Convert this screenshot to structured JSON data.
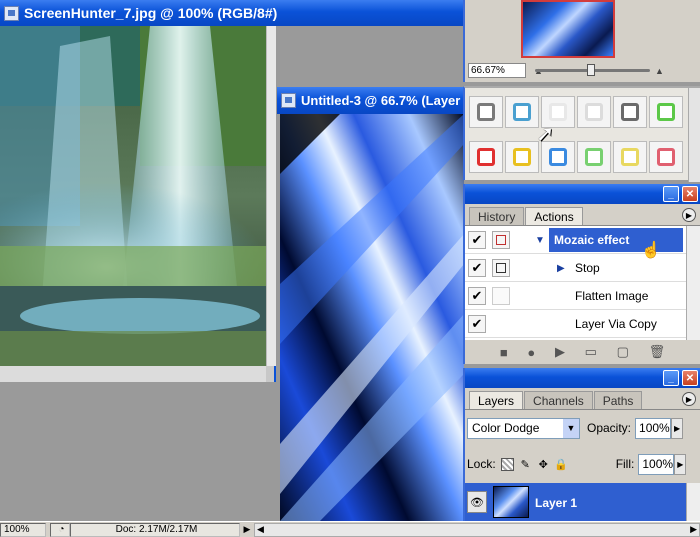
{
  "window1": {
    "title": "ScreenHunter_7.jpg @ 100% (RGB/8#)",
    "buttons": {
      "minimize": "_",
      "maximize": "□",
      "close": "✕"
    }
  },
  "window2": {
    "title": "Untitled-3 @ 66.7% (Layer"
  },
  "statusbar": {
    "zoom": "100%",
    "doc": "Doc: 2.17M/2.17M"
  },
  "navigator": {
    "zoom": "66.67%"
  },
  "styles": {
    "swatches": [
      {
        "color": "#7a7a7a"
      },
      {
        "color": "#4aa0d0"
      },
      {
        "color": "#e8e8e8"
      },
      {
        "color": "#dcdcdc"
      },
      {
        "color": "#6a6a6a"
      },
      {
        "color": "#5cc848"
      },
      {
        "color": "#e03030"
      },
      {
        "color": "#e8c020"
      },
      {
        "color": "#3a8ae0"
      },
      {
        "color": "#78d070"
      },
      {
        "color": "#e8d860"
      },
      {
        "color": "#e06070"
      }
    ]
  },
  "actions_panel": {
    "tabs": [
      "History",
      "Actions"
    ],
    "items": [
      {
        "label": "Mozaic effect",
        "selected": true
      },
      {
        "label": "Stop"
      },
      {
        "label": "Flatten Image"
      },
      {
        "label": "Layer Via Copy"
      }
    ]
  },
  "layers_panel": {
    "tabs": [
      "Layers",
      "Channels",
      "Paths"
    ],
    "blend_mode": "Color Dodge",
    "opacity_label": "Opacity:",
    "opacity": "100%",
    "lock_label": "Lock:",
    "fill_label": "Fill:",
    "fill": "100%",
    "layer_name": "Layer 1"
  },
  "colors": {
    "xp_blue": "#0a52d8",
    "selection": "#2f5fd0"
  }
}
